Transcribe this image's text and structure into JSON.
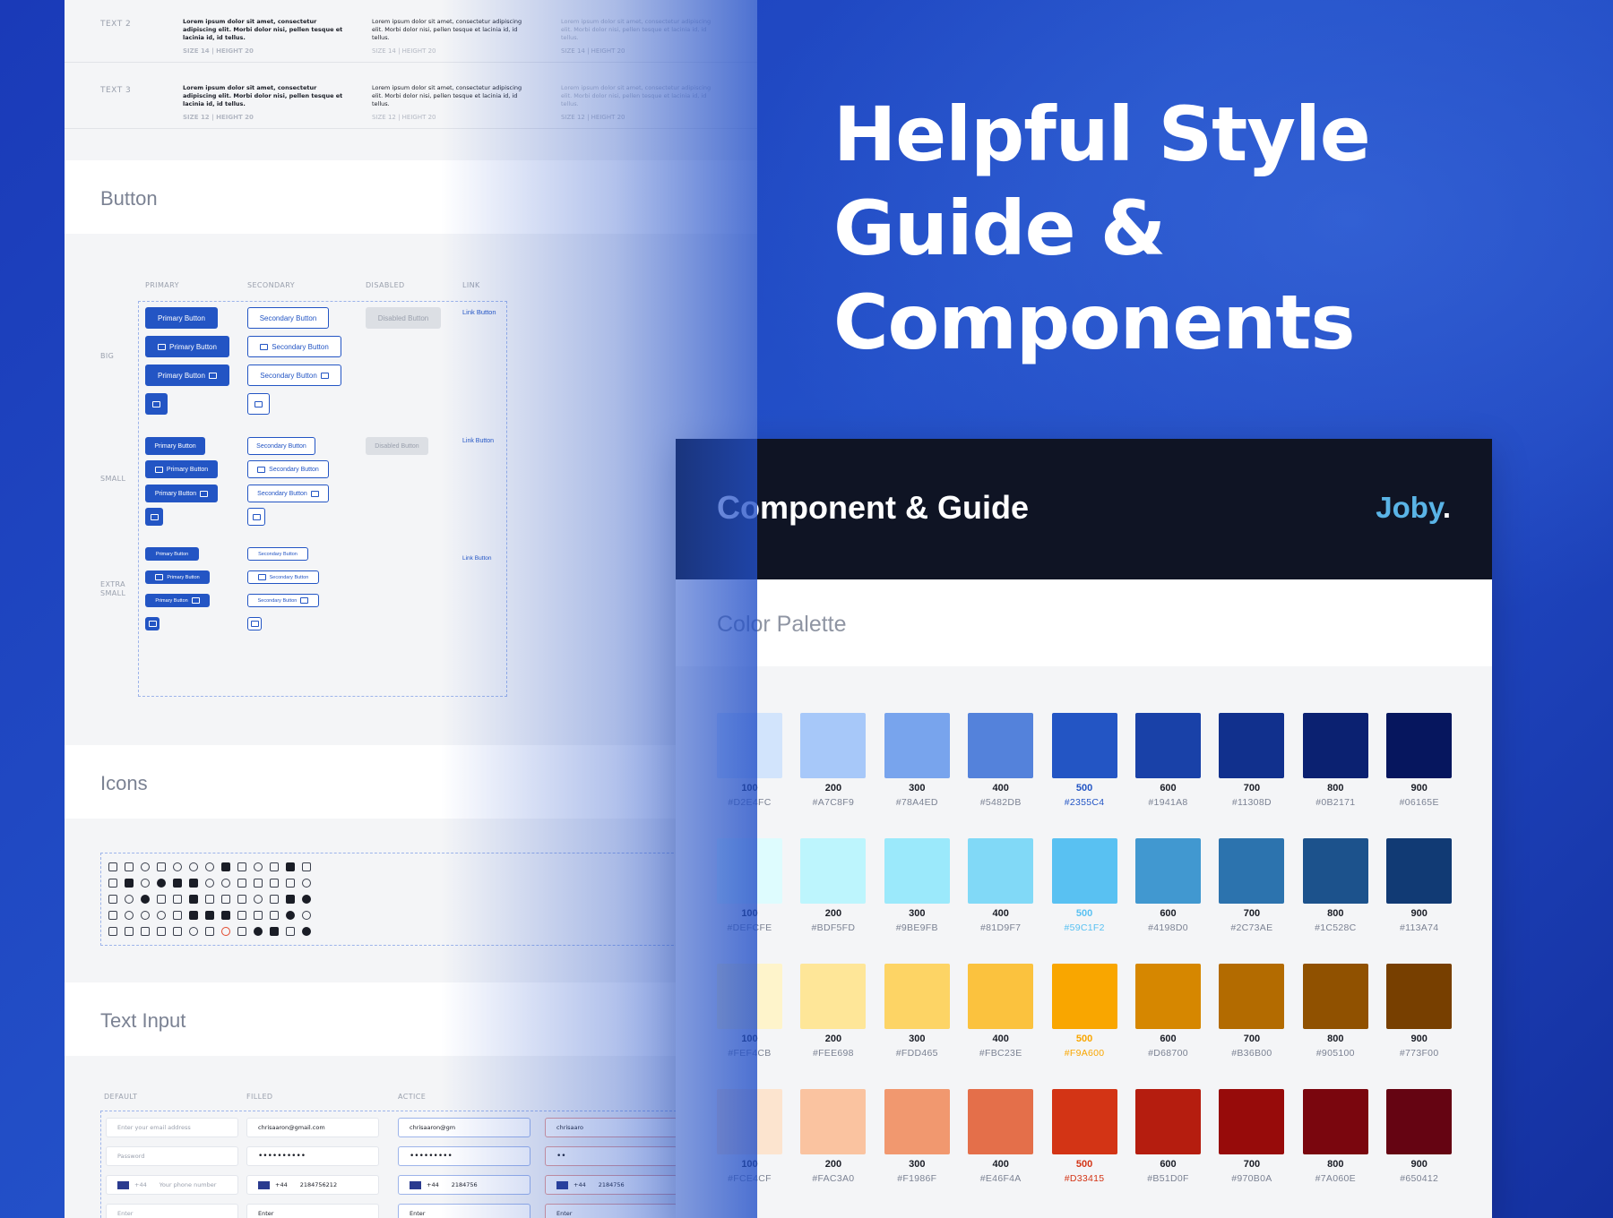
{
  "hero": {
    "line1": "Helpful Style",
    "line2": "Guide &",
    "line3": "Components"
  },
  "typography": {
    "rows": [
      {
        "label": "TEXT 2",
        "text": "Lorem ipsum dolor sit amet, consectetur adipiscing elit. Morbi dolor nisi, pellen tesque et lacinia id, id tellus.",
        "meta": "SIZE 14 | HEIGHT 20"
      },
      {
        "label": "TEXT 3",
        "text": "Lorem ipsum dolor sit amet, consectetur adipiscing elit. Morbi dolor nisi, pellen tesque et lacinia id, id tellus.",
        "meta": "SIZE 12 | HEIGHT 20"
      }
    ]
  },
  "button_section": {
    "title": "Button",
    "columns": [
      "PRIMARY",
      "SECONDARY",
      "DISABLED",
      "LINK"
    ],
    "sizes": [
      "BIG",
      "SMALL",
      "EXTRA SMALL"
    ],
    "primary_label": "Primary Button",
    "secondary_label": "Secondary Button",
    "disabled_label": "Disabled Button",
    "link_label": "Link Button"
  },
  "icons_section": {
    "title": "Icons"
  },
  "text_input_section": {
    "title": "Text Input",
    "columns": [
      "DEFAULT",
      "FILLED",
      "ACTICE"
    ],
    "default": {
      "email": "Enter your email address",
      "password": "Password",
      "phone_code": "+44",
      "phone": "Your phone number",
      "enter": "Enter"
    },
    "filled": {
      "email": "chrisaaron@gmail.com",
      "password": "••••••••••",
      "phone_code": "+44",
      "phone": "2184756212",
      "enter": "Enter"
    },
    "active": {
      "email": "chrisaaron@gm",
      "password": "•••••••••",
      "phone_code": "+44",
      "phone": "2184756",
      "enter": "Enter"
    },
    "error": {
      "email": "chrisaaro",
      "password": "••",
      "phone_code": "+44",
      "phone": "2184756",
      "enter": "Enter"
    }
  },
  "card": {
    "title": "Component & Guide",
    "brand": "Joby",
    "brand_dot": ".",
    "palette_title": "Color Palette",
    "palette": [
      {
        "name": "blue",
        "accent": "#2355C4",
        "swatches": [
          {
            "step": "100",
            "hex": "#D2E4FC"
          },
          {
            "step": "200",
            "hex": "#A7C8F9"
          },
          {
            "step": "300",
            "hex": "#78A4ED"
          },
          {
            "step": "400",
            "hex": "#5482DB"
          },
          {
            "step": "500",
            "hex": "#2355C4"
          },
          {
            "step": "600",
            "hex": "#1941A8"
          },
          {
            "step": "700",
            "hex": "#11308D"
          },
          {
            "step": "800",
            "hex": "#0B2171"
          },
          {
            "step": "900",
            "hex": "#06165E"
          }
        ]
      },
      {
        "name": "sky",
        "accent": "#59C1F2",
        "swatches": [
          {
            "step": "100",
            "hex": "#DEFCFE"
          },
          {
            "step": "200",
            "hex": "#BDF5FD"
          },
          {
            "step": "300",
            "hex": "#9BE9FB"
          },
          {
            "step": "400",
            "hex": "#81D9F7"
          },
          {
            "step": "500",
            "hex": "#59C1F2"
          },
          {
            "step": "600",
            "hex": "#4198D0"
          },
          {
            "step": "700",
            "hex": "#2C73AE"
          },
          {
            "step": "800",
            "hex": "#1C528C"
          },
          {
            "step": "900",
            "hex": "#113A74"
          }
        ]
      },
      {
        "name": "amber",
        "accent": "#F9A600",
        "swatches": [
          {
            "step": "100",
            "hex": "#FEF4CB"
          },
          {
            "step": "200",
            "hex": "#FEE698"
          },
          {
            "step": "300",
            "hex": "#FDD465"
          },
          {
            "step": "400",
            "hex": "#FBC23E"
          },
          {
            "step": "500",
            "hex": "#F9A600"
          },
          {
            "step": "600",
            "hex": "#D68700"
          },
          {
            "step": "700",
            "hex": "#B36B00"
          },
          {
            "step": "800",
            "hex": "#905100"
          },
          {
            "step": "900",
            "hex": "#773F00"
          }
        ]
      },
      {
        "name": "red",
        "accent": "#D33415",
        "swatches": [
          {
            "step": "100",
            "hex": "#FCE4CF"
          },
          {
            "step": "200",
            "hex": "#FAC3A0"
          },
          {
            "step": "300",
            "hex": "#F1986F"
          },
          {
            "step": "400",
            "hex": "#E46F4A"
          },
          {
            "step": "500",
            "hex": "#D33415"
          },
          {
            "step": "600",
            "hex": "#B51D0F"
          },
          {
            "step": "700",
            "hex": "#970B0A"
          },
          {
            "step": "800",
            "hex": "#7A060E"
          },
          {
            "step": "900",
            "hex": "#650412"
          }
        ]
      }
    ]
  }
}
